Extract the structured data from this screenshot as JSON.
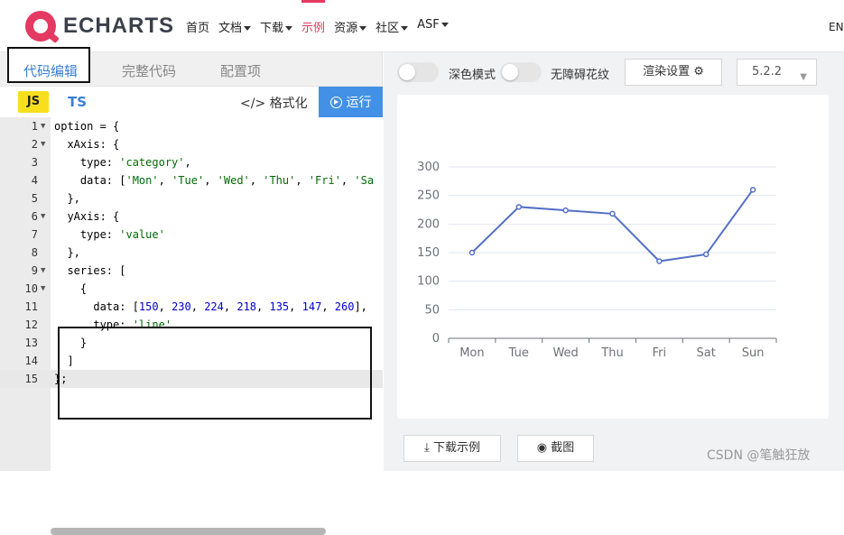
{
  "nav": {
    "logo_text": "ECHARTS",
    "items": [
      "首页",
      "文档",
      "下载",
      "示例",
      "资源",
      "社区",
      "ASF"
    ],
    "lang": "EN"
  },
  "editor": {
    "tabs": [
      "代码编辑",
      "完整代码",
      "配置项"
    ],
    "js_label": "JS",
    "ts_label": "TS",
    "format_label": "格式化",
    "run_label": "运行",
    "lines": [
      {
        "num": "1",
        "fold": true,
        "code": "option = {"
      },
      {
        "num": "2",
        "fold": true,
        "code": "  xAxis: {"
      },
      {
        "num": "3",
        "fold": false,
        "code": "    type: 'category',"
      },
      {
        "num": "4",
        "fold": false,
        "code": "    data: ['Mon', 'Tue', 'Wed', 'Thu', 'Fri', 'Sa"
      },
      {
        "num": "5",
        "fold": false,
        "code": "  },"
      },
      {
        "num": "6",
        "fold": true,
        "code": "  yAxis: {"
      },
      {
        "num": "7",
        "fold": false,
        "code": "    type: 'value'"
      },
      {
        "num": "8",
        "fold": false,
        "code": "  },"
      },
      {
        "num": "9",
        "fold": true,
        "code": "  series: ["
      },
      {
        "num": "10",
        "fold": true,
        "code": "    {"
      },
      {
        "num": "11",
        "fold": false,
        "code": "      data: [150, 230, 224, 218, 135, 147, 260],"
      },
      {
        "num": "12",
        "fold": false,
        "code": "      type: 'line'"
      },
      {
        "num": "13",
        "fold": false,
        "code": "    }"
      },
      {
        "num": "14",
        "fold": false,
        "code": "  ]"
      },
      {
        "num": "15",
        "fold": false,
        "code": "};"
      }
    ]
  },
  "preview": {
    "dark_mode_label": "深色模式",
    "a11y_label": "无障碍花纹",
    "render_label": "渲染设置",
    "version": "5.2.2",
    "download_label": "下载示例",
    "screenshot_label": "截图"
  },
  "watermark": "CSDN @笔触狂放",
  "colors": {
    "accent": "#e43961",
    "link": "#3a7fd5",
    "run": "#4291e6",
    "series": "#5470c6"
  },
  "chart_data": {
    "type": "line",
    "categories": [
      "Mon",
      "Tue",
      "Wed",
      "Thu",
      "Fri",
      "Sat",
      "Sun"
    ],
    "values": [
      150,
      230,
      224,
      218,
      135,
      147,
      260
    ],
    "ylim": [
      0,
      300
    ],
    "yticks": [
      0,
      50,
      100,
      150,
      200,
      250,
      300
    ],
    "grid": true
  }
}
